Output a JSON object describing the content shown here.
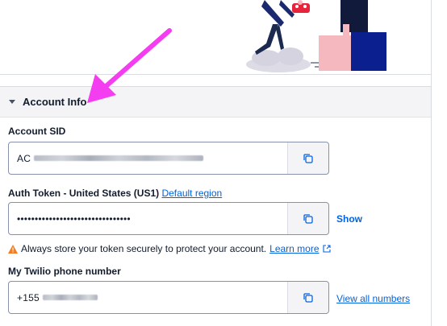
{
  "account_info": {
    "section_title": "Account Info",
    "account_sid": {
      "label": "Account SID",
      "value_prefix": "AC"
    },
    "auth_token": {
      "label": "Auth Token - United States (US1)",
      "region_link": "Default region",
      "masked_value": "••••••••••••••••••••••••••••••••",
      "show_label": "Show"
    },
    "warning": {
      "text": "Always store your token securely to protect your account.",
      "learn_more": "Learn more"
    },
    "phone_number": {
      "label": "My Twilio phone number",
      "value_prefix": "+155",
      "view_all_label": "View all numbers"
    }
  },
  "colors": {
    "link": "#0263e0",
    "annotation_arrow": "#f43cf0",
    "warning": "#f47c22"
  },
  "icons": [
    "caret-down-icon",
    "copy-icon",
    "warning-icon",
    "external-link-icon",
    "annotation-arrow"
  ]
}
